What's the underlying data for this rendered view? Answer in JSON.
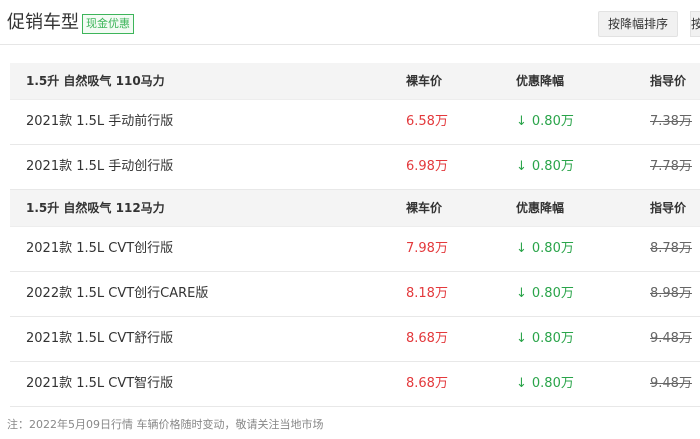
{
  "header": {
    "title": "促销车型",
    "tag": "现金优惠",
    "sort_button": "按降幅排序",
    "sort_button_edge": "按"
  },
  "colors": {
    "price": "#e3393c",
    "discount": "#2aa44a",
    "tag": "#3db55a"
  },
  "groups": [
    {
      "label": "1.5升 自然吸气 110马力",
      "col_price": "裸车价",
      "col_discount": "优惠降幅",
      "col_guide": "指导价",
      "rows": [
        {
          "name": "2021款 1.5L 手动前行版",
          "price": "6.58万",
          "discount": "0.80万",
          "guide": "7.38万"
        },
        {
          "name": "2021款 1.5L 手动创行版",
          "price": "6.98万",
          "discount": "0.80万",
          "guide": "7.78万"
        }
      ]
    },
    {
      "label": "1.5升 自然吸气 112马力",
      "col_price": "裸车价",
      "col_discount": "优惠降幅",
      "col_guide": "指导价",
      "rows": [
        {
          "name": "2021款 1.5L CVT创行版",
          "price": "7.98万",
          "discount": "0.80万",
          "guide": "8.78万"
        },
        {
          "name": "2022款 1.5L CVT创行CARE版",
          "price": "8.18万",
          "discount": "0.80万",
          "guide": "8.98万"
        },
        {
          "name": "2021款 1.5L CVT舒行版",
          "price": "8.68万",
          "discount": "0.80万",
          "guide": "9.48万"
        },
        {
          "name": "2021款 1.5L CVT智行版",
          "price": "8.68万",
          "discount": "0.80万",
          "guide": "9.48万"
        }
      ]
    }
  ],
  "footnote": "注：2022年5月09日行情 车辆价格随时变动，敬请关注当地市场",
  "icons": {
    "discount_arrow": "arrow-down-icon"
  }
}
